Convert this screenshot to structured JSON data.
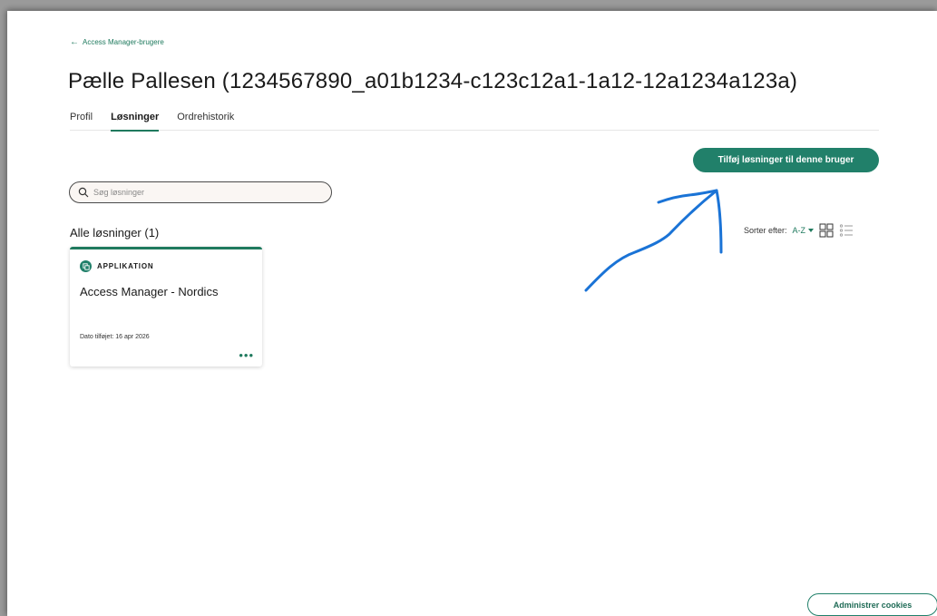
{
  "header": {
    "back_link": "Access Manager-brugere",
    "title": "Pælle Pallesen (1234567890_a01b1234-c123c12a1-1a12-12a1234a123a)"
  },
  "tabs": [
    {
      "label": "Profil",
      "active": false
    },
    {
      "label": "Løsninger",
      "active": true
    },
    {
      "label": "Ordrehistorik",
      "active": false
    }
  ],
  "toolbar": {
    "add_button": "Tilføj løsninger til denne bruger"
  },
  "search": {
    "placeholder": "Søg løsninger",
    "value": ""
  },
  "list": {
    "title": "Alle løsninger (1)",
    "sort_label": "Sorter efter:",
    "sort_value": "A-Z",
    "view_icons": [
      "grid-view-icon",
      "list-view-icon"
    ]
  },
  "cards": [
    {
      "badge": "APPLIKATION",
      "name": "Access Manager - Nordics",
      "date": "Dato tilføjet: 16 apr 2026",
      "more": "•••"
    }
  ],
  "footer": {
    "cookies_button": "Administrer cookies"
  },
  "colors": {
    "accent": "#21806a",
    "annotation": "#1a73d6"
  }
}
